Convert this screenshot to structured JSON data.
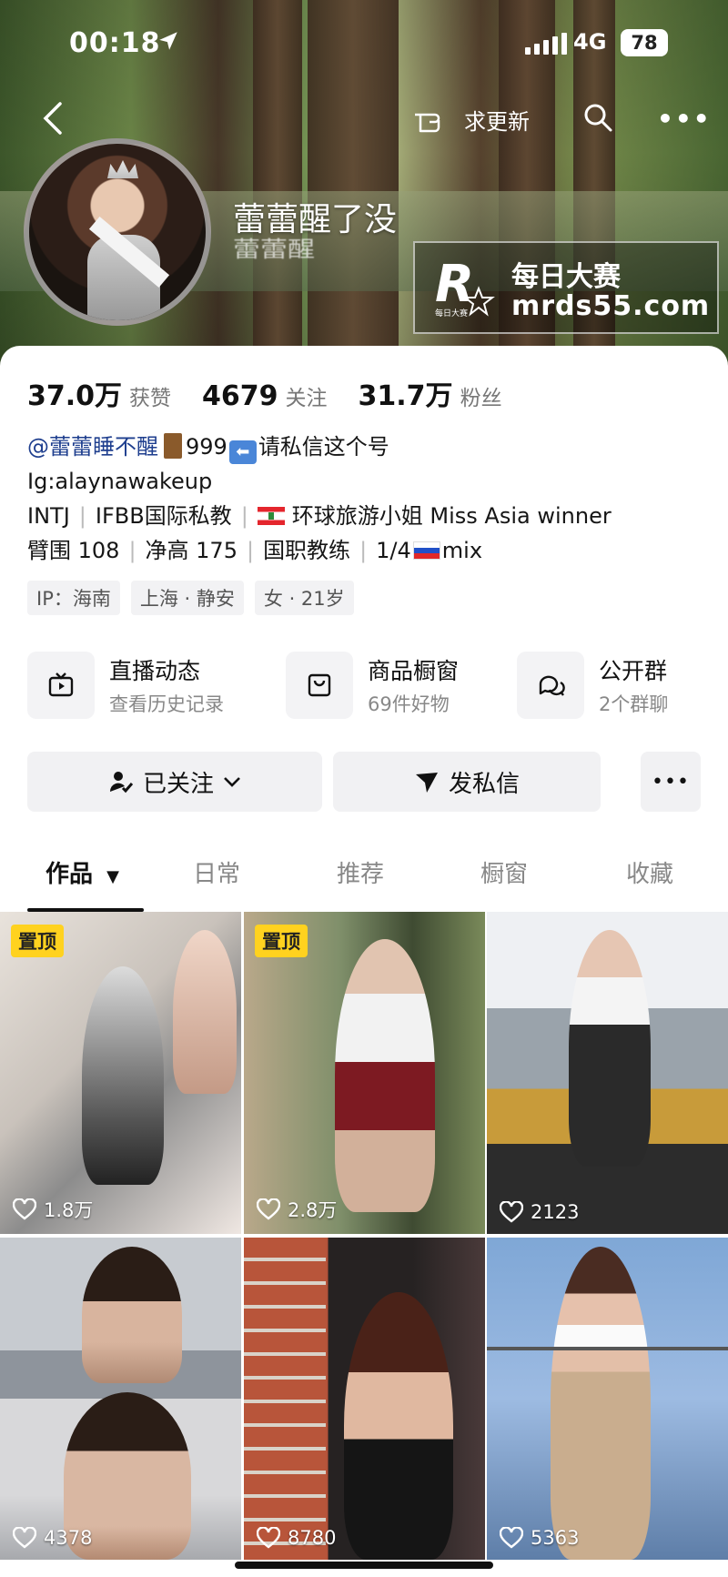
{
  "status_bar": {
    "time": "00:18",
    "network": "4G",
    "battery": "78"
  },
  "topnav": {
    "update_label": "求更新"
  },
  "profile": {
    "nickname": "蕾蕾醒了没",
    "nickname_reflection": "蕾蕾醒"
  },
  "watermark": {
    "logo_letter": "R",
    "logo_sub": "每日大赛",
    "title": "每日大赛",
    "url": "mrds55.com"
  },
  "stats": [
    {
      "value": "37.0万",
      "label": "获赞"
    },
    {
      "value": "4679",
      "label": "关注"
    },
    {
      "value": "31.7万",
      "label": "粉丝"
    }
  ],
  "bio": {
    "mention": "@蕾蕾睡不醒",
    "line1_rest": "999",
    "line1_tail": "请私信这个号",
    "line2": "Ig:alaynawakeup",
    "line3_a": "INTJ",
    "line3_b": "IFBB国际私教",
    "line3_c": "环球旅游小姐 Miss Asia winner",
    "line4_a": "臂围 108",
    "line4_b": "净高 175",
    "line4_c": "国职教练",
    "line4_d1": "1/4",
    "line4_d2": "mix"
  },
  "tags": [
    "IP：海南",
    "上海 · 静安",
    "女 · 21岁"
  ],
  "features": [
    {
      "title": "直播动态",
      "subtitle": "查看历史记录",
      "icon": "tv-icon"
    },
    {
      "title": "商品橱窗",
      "subtitle": "69件好物",
      "icon": "shopping-bag-icon"
    },
    {
      "title": "公开群",
      "subtitle": "2个群聊",
      "icon": "chat-bubbles-icon"
    }
  ],
  "actions": {
    "followed": "已关注",
    "message": "发私信"
  },
  "tabs": [
    {
      "label": "作品"
    },
    {
      "label": "日常"
    },
    {
      "label": "推荐"
    },
    {
      "label": "橱窗"
    },
    {
      "label": "收藏"
    }
  ],
  "videos": [
    {
      "likes": "1.8万",
      "pinned": "置顶"
    },
    {
      "likes": "2.8万",
      "pinned": "置顶"
    },
    {
      "likes": "2123"
    },
    {
      "likes": "4378"
    },
    {
      "likes": "8780"
    },
    {
      "likes": "5363"
    }
  ]
}
